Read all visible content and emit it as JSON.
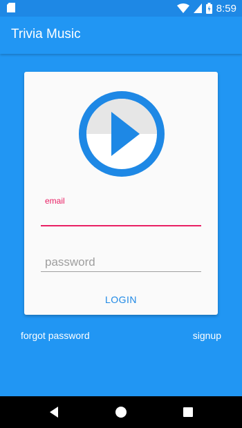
{
  "status_bar": {
    "time": "8:59",
    "icons": [
      "sd-card-icon",
      "wifi-icon",
      "cell-signal-icon",
      "battery-icon"
    ]
  },
  "app_bar": {
    "title": "Trivia Music"
  },
  "login_card": {
    "logo_icon": "play-circle-icon",
    "email": {
      "label": "email",
      "value": ""
    },
    "password": {
      "placeholder": "password",
      "value": ""
    },
    "login_label": "LOGIN"
  },
  "links": {
    "forgot_password": "forgot password",
    "signup": "signup"
  },
  "nav_bar": {
    "icons": [
      "back-icon",
      "home-icon",
      "recents-icon"
    ]
  },
  "colors": {
    "primary": "#2196F3",
    "primary_dark": "#1E88E5",
    "accent": "#E91E63",
    "card": "#fafafa"
  }
}
